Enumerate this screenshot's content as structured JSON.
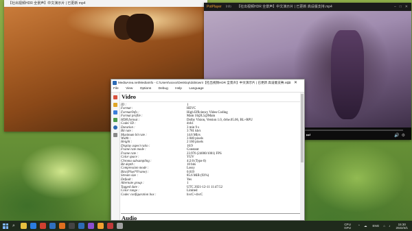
{
  "window_left": {
    "title": "【社出视频HDR 全景声】中文演示片 | 已更新 mp4"
  },
  "player": {
    "app_name": "PotPlayer",
    "tab": "Info",
    "title": "【社出视频HDR 全景声】中文演示片 | 已更新 高设版支持.mp4",
    "progress_fraction": 0.11,
    "accent": "#f0a030"
  },
  "mediainfo": {
    "title": "MediaArea.net/MediaInfo - C:\\Users\\xxxxx\\Desktop\\dobtown\\【社出视频HDR 全景声】中文演示片 | 已更新 高设版支持.mp4",
    "menu": [
      "File",
      "View",
      "Options",
      "Debug",
      "Help",
      "Language"
    ],
    "section_video": "Video",
    "section_audio": "Audio",
    "video_fields": [
      {
        "k": "ID :",
        "v": "1"
      },
      {
        "k": "Format :",
        "v": "HEVC"
      },
      {
        "k": "Format/Info :",
        "v": "High Efficiency Video Coding"
      },
      {
        "k": "Format profile :",
        "v": "Main 10@L5@Main"
      },
      {
        "k": "HDR format :",
        "v": "Dolby Vision, Version 1.0, dvhe.05.06, BL+RPU"
      },
      {
        "k": "Codec ID :",
        "v": "dvh1"
      },
      {
        "k": "Duration :",
        "v": "3 min 9 s"
      },
      {
        "k": "Bit rate :",
        "v": "3 781 kb/s"
      },
      {
        "k": "Maximum bit rate :",
        "v": "14.6 Mb/s"
      },
      {
        "k": "Width :",
        "v": "3 840 pixels"
      },
      {
        "k": "Height :",
        "v": "2 160 pixels"
      },
      {
        "k": "Display aspect ratio :",
        "v": "16:9"
      },
      {
        "k": "Frame rate mode :",
        "v": "Constant"
      },
      {
        "k": "Frame rate :",
        "v": "23.976 (24000/1001) FPS"
      },
      {
        "k": "Color space :",
        "v": "YUV"
      },
      {
        "k": "Chroma subsampling :",
        "v": "4:2:0 (Type 0)"
      },
      {
        "k": "Bit depth :",
        "v": "10 bits"
      },
      {
        "k": "Compression mode :",
        "v": "Lossy"
      },
      {
        "k": "Bits/(Pixel*Frame) :",
        "v": "0.019"
      },
      {
        "k": "Stream size :",
        "v": "85.6 MiB (93%)"
      },
      {
        "k": "Default :",
        "v": "Yes"
      },
      {
        "k": "Alternate group :",
        "v": "1"
      },
      {
        "k": "Tagged date :",
        "v": "UTC 2021-12-11 11:47:52"
      },
      {
        "k": "Color range :",
        "v": "Limited"
      },
      {
        "k": "Codec configuration box :",
        "v": "hvcC+dvcC"
      }
    ]
  },
  "taskbar": {
    "perf_top": "CPU",
    "perf_bottom": "GPU",
    "lang": "ENG",
    "time": "15:30",
    "date": "2022/4/1"
  }
}
